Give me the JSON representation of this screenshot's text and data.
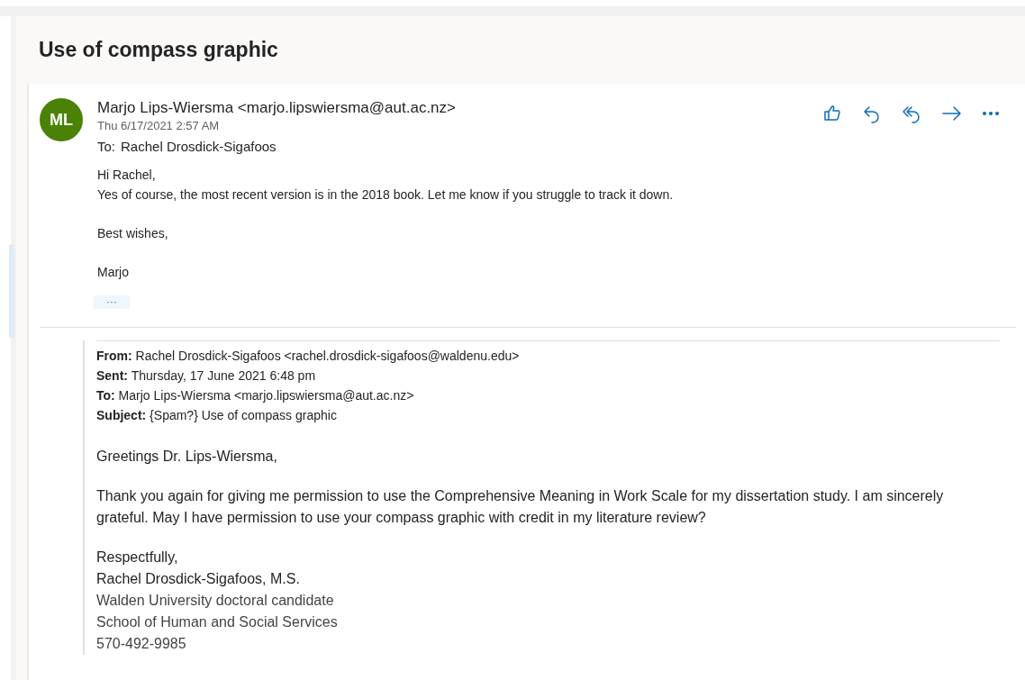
{
  "subject": "Use of compass graphic",
  "message": {
    "avatar_initials": "ML",
    "sender": "Marjo Lips-Wiersma <marjo.lipswiersma@aut.ac.nz>",
    "date": "Thu 6/17/2021 2:57 AM",
    "to_label": "To:",
    "to": "Rachel Drosdick-Sigafoos",
    "body": [
      [
        "Hi Rachel,",
        "Yes of course, the most recent version is in the 2018 book. Let me know if you struggle to track it down."
      ],
      [
        "Best wishes,"
      ],
      [
        "Marjo"
      ]
    ],
    "expand_label": "···"
  },
  "quoted": {
    "headers": [
      {
        "label": "From:",
        "value": "Rachel Drosdick-Sigafoos <rachel.drosdick-sigafoos@waldenu.edu>"
      },
      {
        "label": "Sent:",
        "value": "Thursday, 17 June 2021 6:48 pm"
      },
      {
        "label": "To:",
        "value": "Marjo Lips-Wiersma <marjo.lipswiersma@aut.ac.nz>"
      },
      {
        "label": "Subject:",
        "value": "{Spam?} Use of compass graphic"
      }
    ],
    "body": [
      {
        "kind": "para",
        "lines": [
          "Greetings Dr. Lips-Wiersma,"
        ]
      },
      {
        "kind": "para",
        "lines": [
          "Thank you again for giving me permission to use the Comprehensive Meaning in Work Scale for my dissertation study. I am sincerely grateful. May I have permission to use your compass graphic with credit in my literature review?"
        ]
      },
      {
        "kind": "signature",
        "lines": [
          "Respectfully,",
          "Rachel Drosdick-Sigafoos, M.S."
        ],
        "details": [
          "Walden University doctoral candidate",
          "School of Human and Social Services",
          "570-492-9985"
        ]
      }
    ]
  }
}
